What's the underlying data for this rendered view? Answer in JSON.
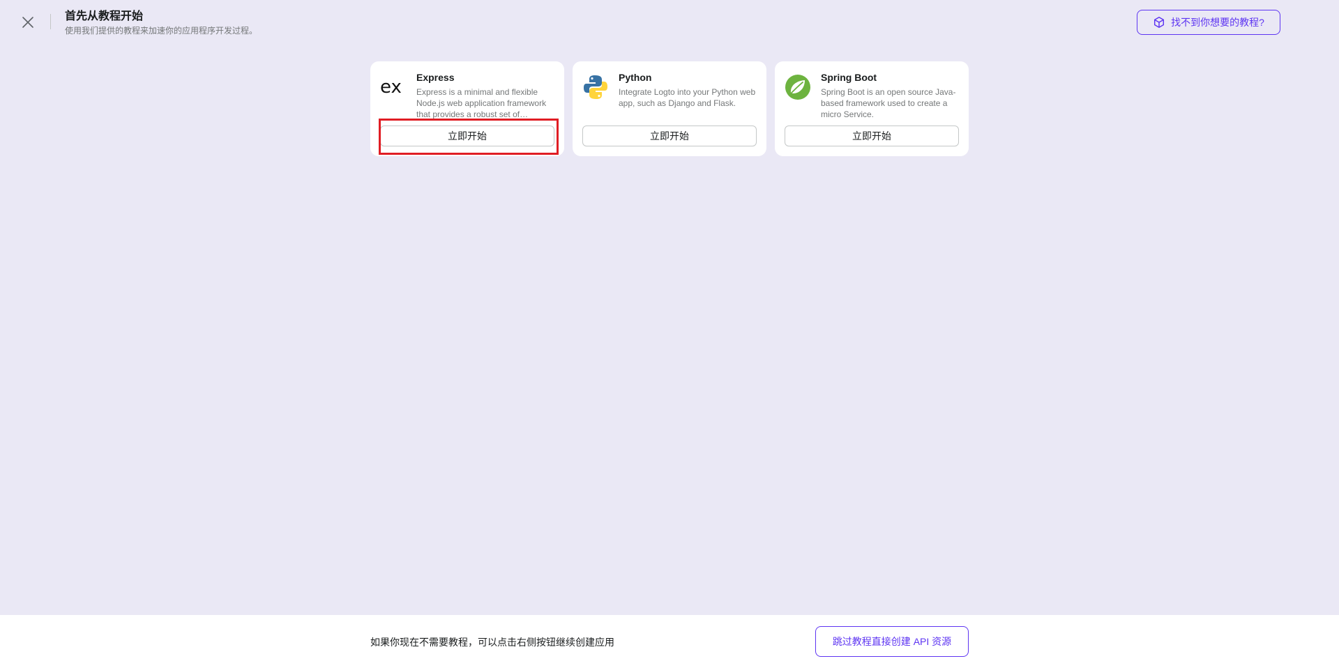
{
  "header": {
    "title": "首先从教程开始",
    "subtitle": "使用我们提供的教程来加速你的应用程序开发过程。",
    "help_button": "找不到你想要的教程?"
  },
  "cards": [
    {
      "name": "Express",
      "description": "Express is a minimal and flexible Node.js web application framework that provides a robust set of features.",
      "button": "立即开始",
      "logo": "express-logo"
    },
    {
      "name": "Python",
      "description": "Integrate Logto into your Python web app, such as Django and Flask.",
      "button": "立即开始",
      "logo": "python-logo"
    },
    {
      "name": "Spring Boot",
      "description": "Spring Boot is an open source Java-based framework used to create a micro Service.",
      "button": "立即开始",
      "logo": "spring-boot-logo"
    }
  ],
  "footer": {
    "text": "如果你现在不需要教程，可以点击右侧按钮继续创建应用",
    "skip_button": "跳过教程直接创建 API 资源"
  },
  "colors": {
    "background": "#eae8f5",
    "accent": "#5d34f2",
    "highlight": "#e01d24"
  }
}
